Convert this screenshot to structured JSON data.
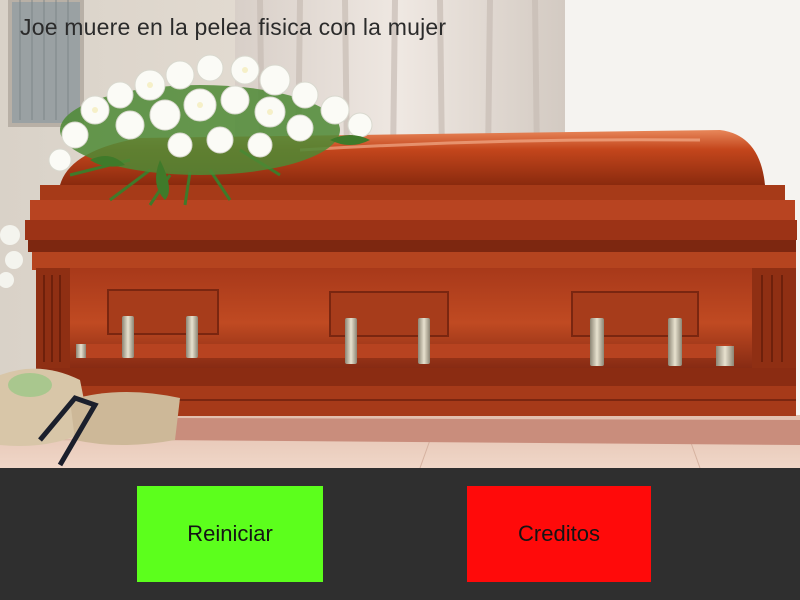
{
  "scene": {
    "caption": "Joe muere en la pelea fisica con la mujer",
    "image": "funeral-casket-with-white-flowers"
  },
  "buttons": {
    "restart": {
      "label": "Reiniciar",
      "color": "#5cff1c"
    },
    "credits": {
      "label": "Creditos",
      "color": "#ff0a0a"
    }
  },
  "colors": {
    "bottom_bar": "#2f2f2f"
  }
}
